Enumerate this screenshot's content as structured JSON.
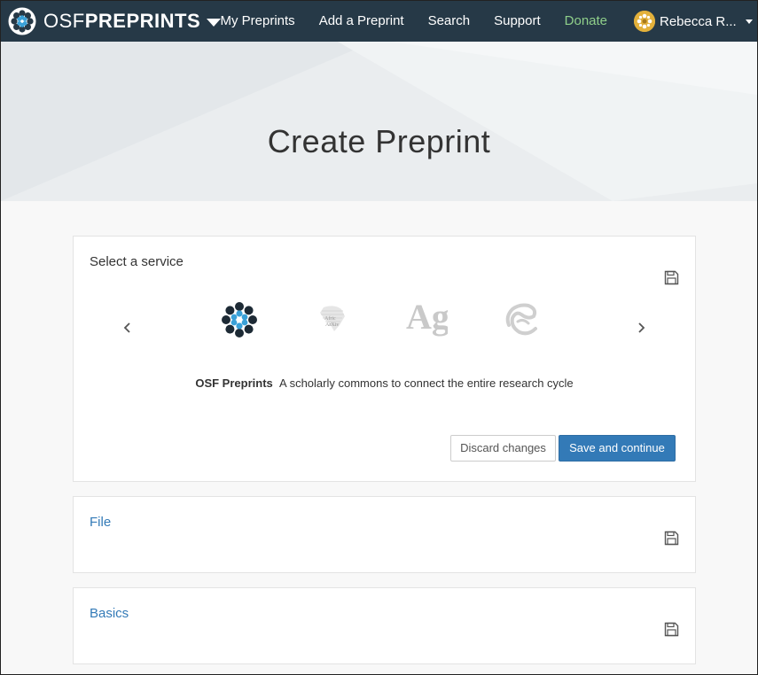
{
  "navbar": {
    "brand_osf": "OSF",
    "brand_preprints": "PREPRINTS",
    "items": [
      {
        "label": "My Preprints"
      },
      {
        "label": "Add a Preprint"
      },
      {
        "label": "Search"
      },
      {
        "label": "Support"
      },
      {
        "label": "Donate"
      }
    ],
    "user_name": "Rebecca R..."
  },
  "hero": {
    "title": "Create Preprint"
  },
  "service_panel": {
    "title": "Select a service",
    "selected_name": "OSF Preprints",
    "selected_description": "A scholarly commons to connect the entire research cycle",
    "discard_label": "Discard changes",
    "save_label": "Save and continue",
    "services": [
      {
        "icon": "osf-preprints-logo"
      },
      {
        "icon": "africarxiv-logo"
      },
      {
        "icon": "agrixiv-logo"
      },
      {
        "icon": "arabixiv-logo"
      }
    ]
  },
  "file_panel": {
    "title": "File"
  },
  "basics_panel": {
    "title": "Basics"
  },
  "colors": {
    "navbar": "#263947",
    "link": "#337ab7",
    "primary_button": "#337ab7",
    "donate": "#8fcf8a"
  }
}
